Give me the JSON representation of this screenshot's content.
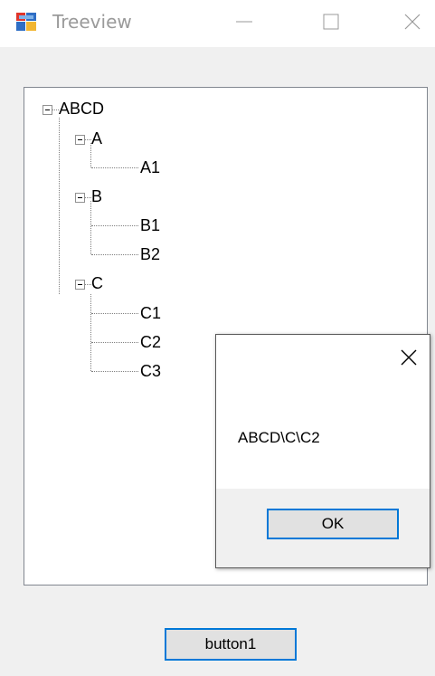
{
  "window": {
    "title": "Treeview",
    "controls": [
      "minimize-icon",
      "maximize-icon",
      "close-icon"
    ]
  },
  "tree": {
    "root": {
      "label": "ABCD",
      "children": [
        {
          "label": "A",
          "children": [
            {
              "label": "A1"
            }
          ]
        },
        {
          "label": "B",
          "children": [
            {
              "label": "B1"
            },
            {
              "label": "B2"
            }
          ]
        },
        {
          "label": "C",
          "children": [
            {
              "label": "C1"
            },
            {
              "label": "C2"
            },
            {
              "label": "C3"
            }
          ]
        }
      ]
    }
  },
  "dialog": {
    "message": "ABCD\\C\\C2",
    "ok_label": "OK"
  },
  "button1": {
    "label": "button1"
  },
  "colors": {
    "window_bg": "#f0f0f0",
    "button_border": "#0078d7",
    "button_bg": "#e1e1e1",
    "tree_border": "#828790"
  }
}
